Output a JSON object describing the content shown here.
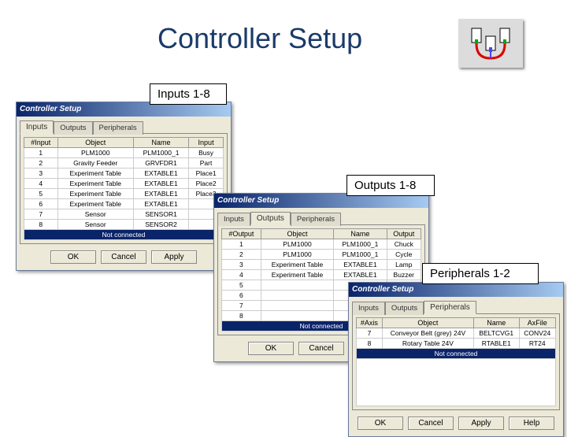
{
  "slide_title": "Controller Setup",
  "labels": {
    "inputs": "Inputs 1-8",
    "outputs": "Outputs 1-8",
    "periph": "Peripherals 1-2"
  },
  "dlg_title": "Controller Setup",
  "tabs": {
    "inputs": "Inputs",
    "outputs": "Outputs",
    "periph": "Peripherals"
  },
  "not_connected": "Not connected",
  "buttons": {
    "ok": "OK",
    "cancel": "Cancel",
    "apply": "Apply",
    "help": "Help"
  },
  "inputs": {
    "headers": [
      "#Input",
      "Object",
      "Name",
      "Input"
    ],
    "rows": [
      [
        "1",
        "PLM1000",
        "PLM1000_1",
        "Busy"
      ],
      [
        "2",
        "Gravity Feeder",
        "GRVFDR1",
        "Part"
      ],
      [
        "3",
        "Experiment Table",
        "EXTABLE1",
        "Place1"
      ],
      [
        "4",
        "Experiment Table",
        "EXTABLE1",
        "Place2"
      ],
      [
        "5",
        "Experiment Table",
        "EXTABLE1",
        "Place3"
      ],
      [
        "6",
        "Experiment Table",
        "EXTABLE1",
        ""
      ],
      [
        "7",
        "Sensor",
        "SENSOR1",
        ""
      ],
      [
        "8",
        "Sensor",
        "SENSOR2",
        ""
      ]
    ]
  },
  "outputs": {
    "headers": [
      "#Output",
      "Object",
      "Name",
      "Output"
    ],
    "rows": [
      [
        "1",
        "PLM1000",
        "PLM1000_1",
        "Chuck"
      ],
      [
        "2",
        "PLM1000",
        "PLM1000_1",
        "Cycle"
      ],
      [
        "3",
        "Experiment Table",
        "EXTABLE1",
        "Lamp"
      ],
      [
        "4",
        "Experiment Table",
        "EXTABLE1",
        "Buzzer"
      ],
      [
        "5",
        "",
        "",
        ""
      ],
      [
        "6",
        "",
        "",
        ""
      ],
      [
        "7",
        "",
        "",
        ""
      ],
      [
        "8",
        "",
        "",
        ""
      ]
    ]
  },
  "periph": {
    "headers": [
      "#Axis",
      "Object",
      "Name",
      "AxFile"
    ],
    "rows": [
      [
        "7",
        "Conveyor Belt (grey) 24V",
        "BELTCVG1",
        "CONV24"
      ],
      [
        "8",
        "Rotary Table 24V",
        "RTABLE1",
        "RT24"
      ]
    ]
  }
}
